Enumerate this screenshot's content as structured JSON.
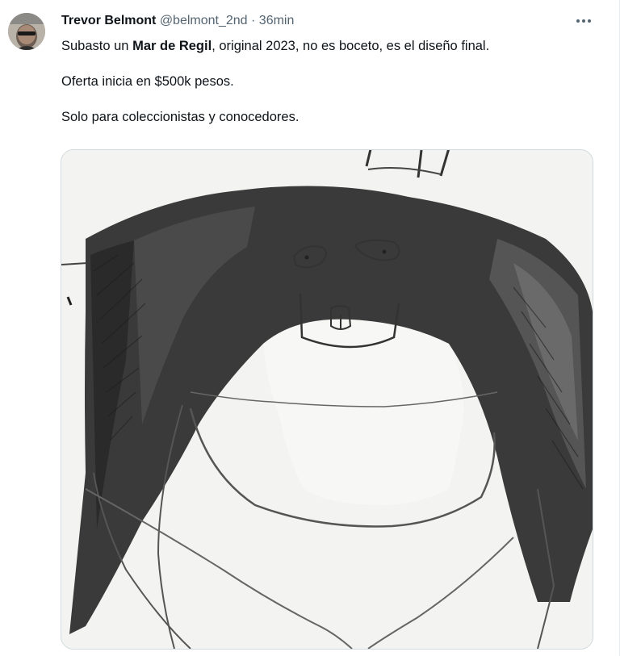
{
  "tweet": {
    "author_name": "Trevor Belmont",
    "author_handle": "@belmont_2nd",
    "separator": " · ",
    "time": "36min",
    "line1_before": "Subasto un ",
    "line1_bold": "Mar de Regil",
    "line1_after": ", original 2023, no es boceto, es el diseño final.",
    "line2": "Oferta inicia en $500k pesos.",
    "line3": "Solo para coleccionistas y conocedores."
  },
  "icons": {
    "more": "more-horizontal-icon"
  }
}
